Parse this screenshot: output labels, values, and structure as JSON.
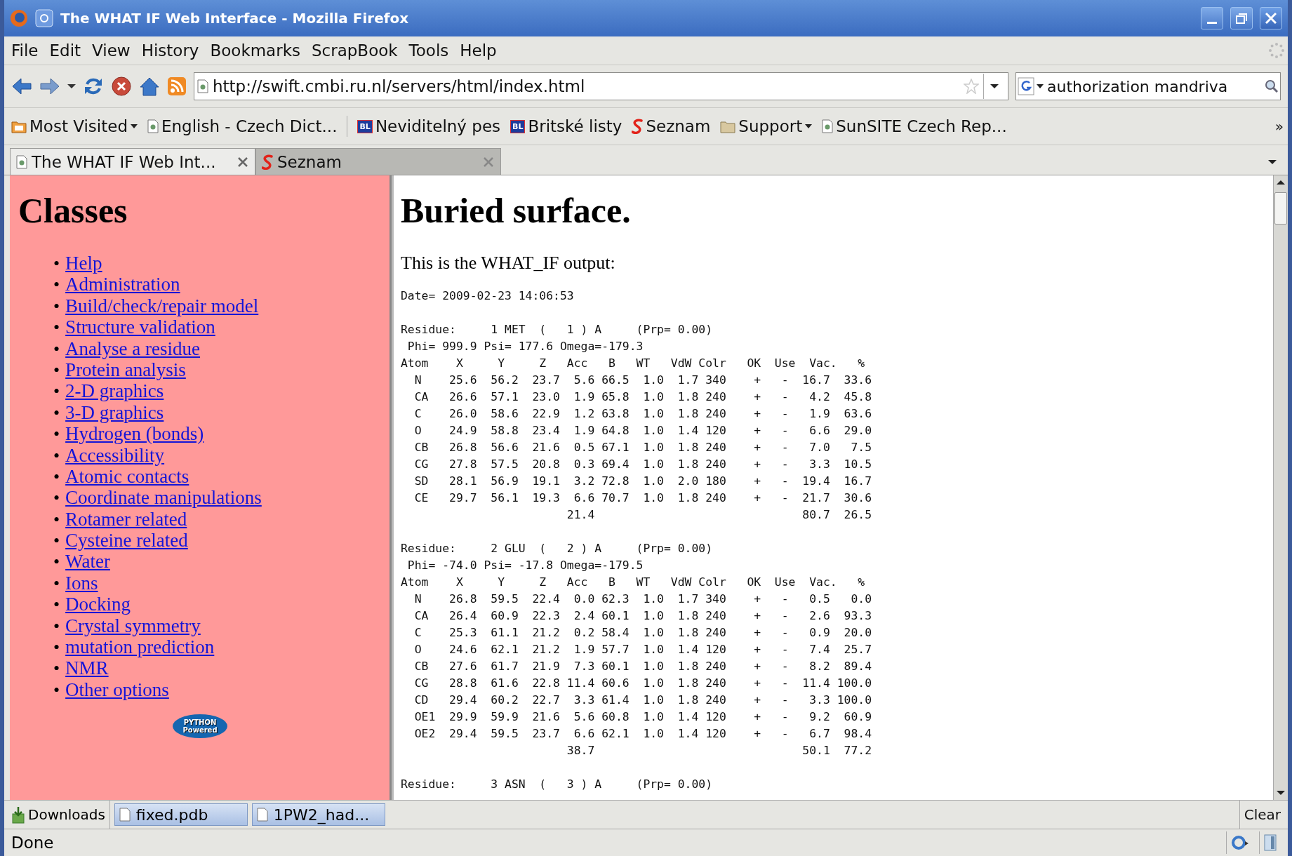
{
  "window": {
    "title": "The WHAT IF Web Interface - Mozilla Firefox"
  },
  "menu": [
    "File",
    "Edit",
    "View",
    "History",
    "Bookmarks",
    "ScrapBook",
    "Tools",
    "Help"
  ],
  "address": {
    "value": "http://swift.cmbi.ru.nl/servers/html/index.html"
  },
  "search": {
    "value": "authorization mandriva"
  },
  "bookmarks": [
    {
      "label": "Most Visited",
      "kind": "folder-menu"
    },
    {
      "label": "English - Czech Dict...",
      "kind": "page"
    },
    {
      "label": "Neviditelný pes",
      "kind": "badge",
      "badge": "BL"
    },
    {
      "label": "Britské listy",
      "kind": "badge",
      "badge": "BL"
    },
    {
      "label": "Seznam",
      "kind": "seznam"
    },
    {
      "label": "Support",
      "kind": "folder-menu"
    },
    {
      "label": "SunSITE Czech Rep...",
      "kind": "page"
    }
  ],
  "bookmarks_more": "»",
  "tabs": [
    {
      "label": "The WHAT IF Web Int...",
      "kind": "page",
      "selected": true
    },
    {
      "label": "Seznam",
      "kind": "seznam",
      "selected": false
    }
  ],
  "sidebar": {
    "heading": "Classes",
    "links": [
      "Help",
      "Administration",
      "Build/check/repair model",
      "Structure validation",
      "Analyse a residue",
      "Protein analysis",
      "2-D graphics",
      "3-D graphics",
      "Hydrogen (bonds)",
      "Accessibility",
      "Atomic contacts",
      "Coordinate manipulations",
      "Rotamer related",
      "Cysteine related",
      "Water",
      "Ions",
      "Docking",
      "Crystal symmetry",
      "mutation prediction",
      "NMR",
      "Other options"
    ],
    "bullet": "•",
    "badge": [
      "PYTHON",
      "Powered"
    ]
  },
  "content": {
    "heading": "Buried surface.",
    "intro": "This is the WHAT_IF output:",
    "date": "Date= 2009-02-23 14:06:53",
    "residues": [
      {
        "title": "Residue:     1 MET  (   1 ) A     (Prp= 0.00)",
        "angles": " Phi= 999.9 Psi= 177.6 Omega=-179.3",
        "header": "Atom    X     Y     Z   Acc   B   WT   VdW Colr   OK  Use  Vac.   %",
        "atoms": [
          [
            "N",
            "25.6",
            "56.2",
            "23.7",
            "5.6",
            "66.5",
            "1.0",
            "1.7",
            "340",
            "+",
            "-",
            "16.7",
            "33.6"
          ],
          [
            "CA",
            "26.6",
            "57.1",
            "23.0",
            "1.9",
            "65.8",
            "1.0",
            "1.8",
            "240",
            "+",
            "-",
            "4.2",
            "45.8"
          ],
          [
            "C",
            "26.0",
            "58.6",
            "22.9",
            "1.2",
            "63.8",
            "1.0",
            "1.8",
            "240",
            "+",
            "-",
            "1.9",
            "63.6"
          ],
          [
            "O",
            "24.9",
            "58.8",
            "23.4",
            "1.9",
            "64.8",
            "1.0",
            "1.4",
            "120",
            "+",
            "-",
            "6.6",
            "29.0"
          ],
          [
            "CB",
            "26.8",
            "56.6",
            "21.6",
            "0.5",
            "67.1",
            "1.0",
            "1.8",
            "240",
            "+",
            "-",
            "7.0",
            "7.5"
          ],
          [
            "CG",
            "27.8",
            "57.5",
            "20.8",
            "0.3",
            "69.4",
            "1.0",
            "1.8",
            "240",
            "+",
            "-",
            "3.3",
            "10.5"
          ],
          [
            "SD",
            "28.1",
            "56.9",
            "19.1",
            "3.2",
            "72.8",
            "1.0",
            "2.0",
            "180",
            "+",
            "-",
            "19.4",
            "16.7"
          ],
          [
            "CE",
            "29.7",
            "56.1",
            "19.3",
            "6.6",
            "70.7",
            "1.0",
            "1.8",
            "240",
            "+",
            "-",
            "21.7",
            "30.6"
          ]
        ],
        "totals": [
          "21.4",
          "80.7",
          "26.5"
        ]
      },
      {
        "title": "Residue:     2 GLU  (   2 ) A     (Prp= 0.00)",
        "angles": " Phi= -74.0 Psi= -17.8 Omega=-179.5",
        "header": "Atom    X     Y     Z   Acc   B   WT   VdW Colr   OK  Use  Vac.   %",
        "atoms": [
          [
            "N",
            "26.8",
            "59.5",
            "22.4",
            "0.0",
            "62.3",
            "1.0",
            "1.7",
            "340",
            "+",
            "-",
            "0.5",
            "0.0"
          ],
          [
            "CA",
            "26.4",
            "60.9",
            "22.3",
            "2.4",
            "60.1",
            "1.0",
            "1.8",
            "240",
            "+",
            "-",
            "2.6",
            "93.3"
          ],
          [
            "C",
            "25.3",
            "61.1",
            "21.2",
            "0.2",
            "58.4",
            "1.0",
            "1.8",
            "240",
            "+",
            "-",
            "0.9",
            "20.0"
          ],
          [
            "O",
            "24.6",
            "62.1",
            "21.2",
            "1.9",
            "57.7",
            "1.0",
            "1.4",
            "120",
            "+",
            "-",
            "7.4",
            "25.7"
          ],
          [
            "CB",
            "27.6",
            "61.7",
            "21.9",
            "7.3",
            "60.1",
            "1.0",
            "1.8",
            "240",
            "+",
            "-",
            "8.2",
            "89.4"
          ],
          [
            "CG",
            "28.8",
            "61.6",
            "22.8",
            "11.4",
            "60.6",
            "1.0",
            "1.8",
            "240",
            "+",
            "-",
            "11.4",
            "100.0"
          ],
          [
            "CD",
            "29.4",
            "60.2",
            "22.7",
            "3.3",
            "61.4",
            "1.0",
            "1.8",
            "240",
            "+",
            "-",
            "3.3",
            "100.0"
          ],
          [
            "OE1",
            "29.9",
            "59.9",
            "21.6",
            "5.6",
            "60.8",
            "1.0",
            "1.4",
            "120",
            "+",
            "-",
            "9.2",
            "60.9"
          ],
          [
            "OE2",
            "29.4",
            "59.5",
            "23.7",
            "6.6",
            "62.1",
            "1.0",
            "1.4",
            "120",
            "+",
            "-",
            "6.7",
            "98.4"
          ]
        ],
        "totals": [
          "38.7",
          "50.1",
          "77.2"
        ]
      },
      {
        "title": "Residue:     3 ASN  (   3 ) A     (Prp= 0.00)"
      }
    ]
  },
  "downloads": {
    "label": "Downloads",
    "items": [
      "fixed.pdb",
      "1PW2_had..."
    ],
    "clear": "Clear"
  },
  "status": "Done"
}
